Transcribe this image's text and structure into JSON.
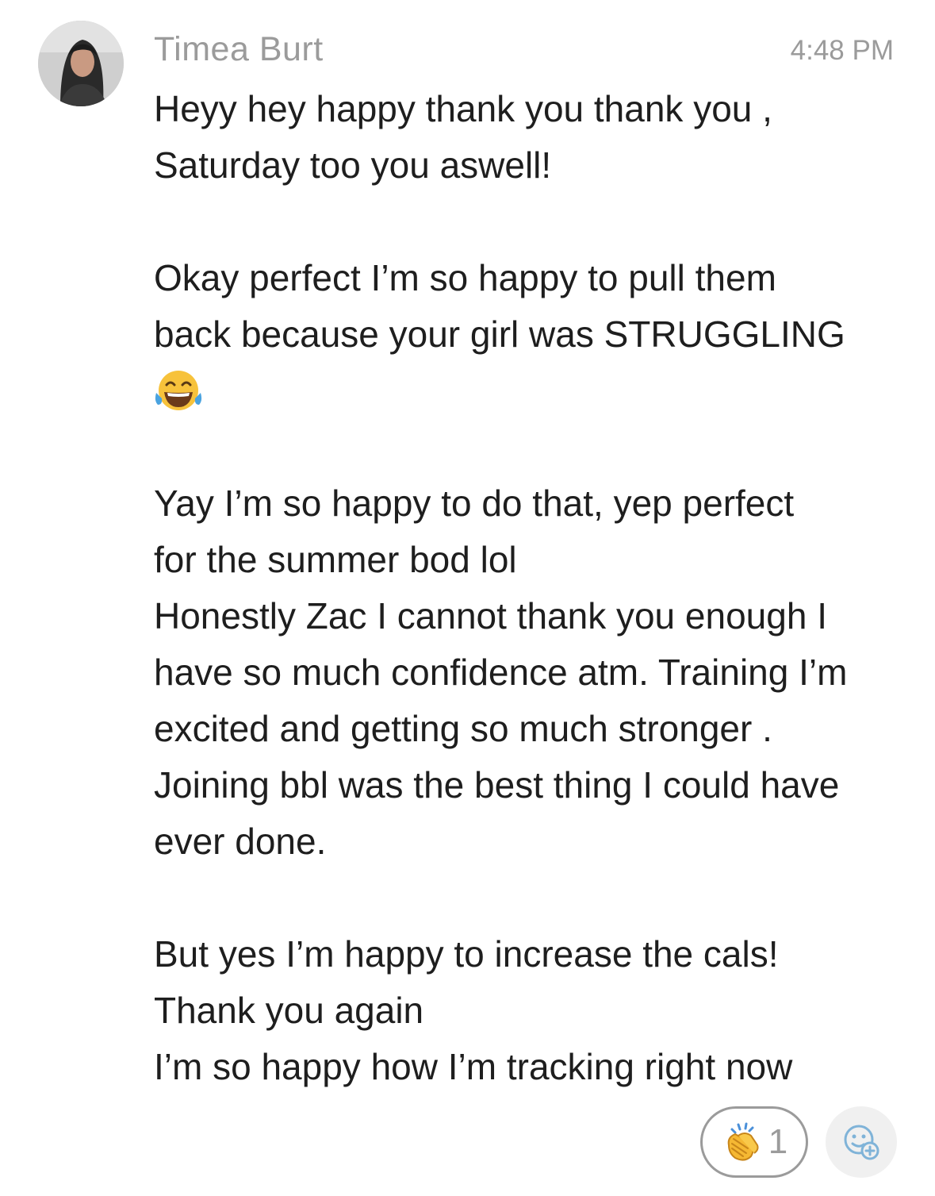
{
  "message": {
    "sender": "Timea Burt",
    "time": "4:48 PM",
    "paragraphs": {
      "p1": [
        "Heyy hey happy  thank you thank you ,",
        "Saturday too you aswell!"
      ],
      "p2": [
        "Okay perfect I’m so happy to pull them",
        "back because your girl was STRUGGLING"
      ],
      "p3": [
        "Yay I’m so happy to do that, yep perfect",
        "for the summer bod lol",
        "Honestly Zac I cannot thank you enough I",
        "have so much confidence atm. Training I’m",
        "excited and getting so much stronger .",
        "Joining bbl was the best thing I could have",
        "ever done."
      ],
      "p4": [
        "But yes I’m happy to increase the cals!",
        "Thank you again",
        "I’m so happy how I’m tracking right now"
      ]
    },
    "inline_emoji": "face-with-tears-of-joy"
  },
  "reactions": {
    "clap": {
      "emoji": "clapping-hands",
      "count": "1"
    },
    "add_reaction_icon": "add-reaction-icon"
  },
  "colors": {
    "text": "#1e1e1e",
    "muted": "#9b9b9b",
    "pill_border": "#9b9b9b",
    "add_bg": "#f0f0f0",
    "icon_blue": "#7fb3d8"
  }
}
